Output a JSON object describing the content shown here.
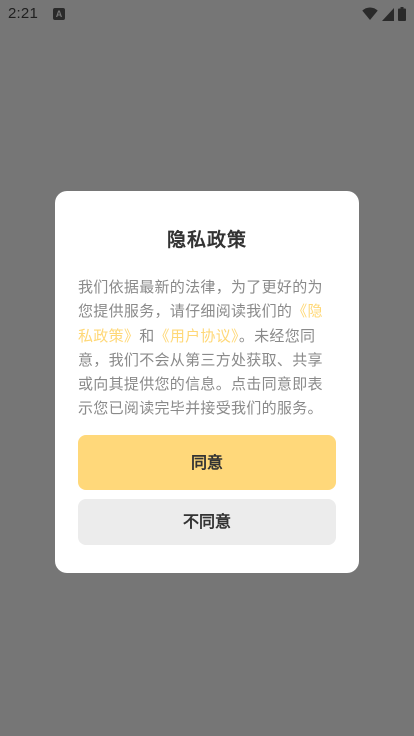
{
  "status_bar": {
    "time": "2:21",
    "app_icon": "A",
    "icons": [
      "wifi-icon",
      "signal-icon",
      "battery-icon"
    ]
  },
  "dialog": {
    "title": "隐私政策",
    "body_before": "我们依据最新的法律，为了更好的为您提供服务，请仔细阅读我们的",
    "privacy_link": "《隐私政策》",
    "and": "和",
    "agreement_link": "《用户协议》",
    "body_after": "。未经您同意，我们不会从第三方处获取、共享或向其提供您的信息。点击同意即表示您已阅读完毕并接受我们的服务。",
    "agree_label": "同意",
    "disagree_label": "不同意"
  },
  "colors": {
    "overlay": "#767676",
    "accent": "#ffd87a",
    "link": "#ffd877",
    "secondary_button": "#ececec"
  }
}
